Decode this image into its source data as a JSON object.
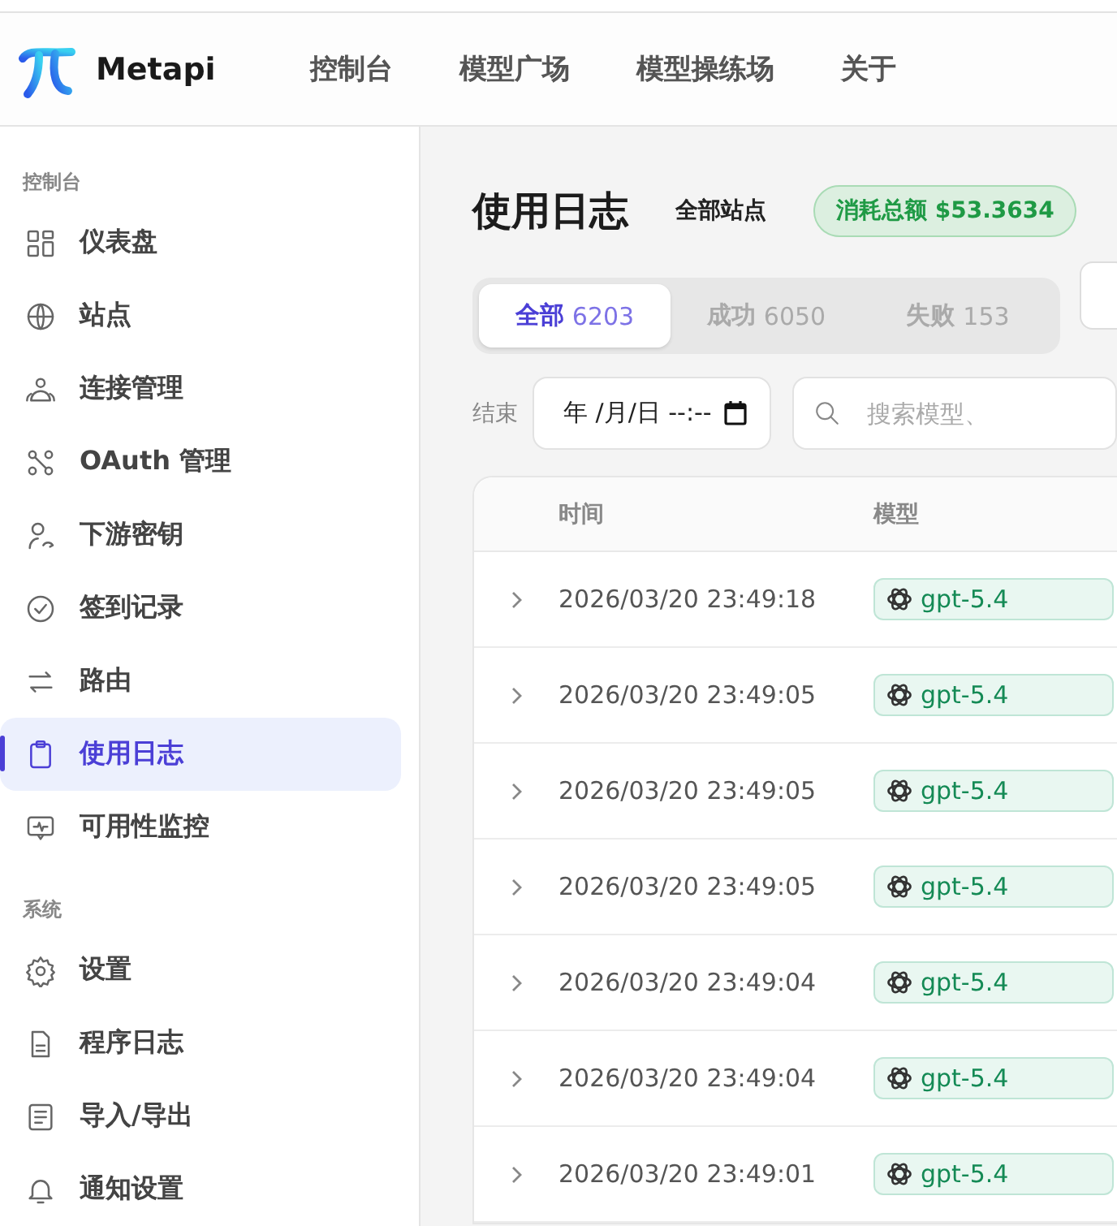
{
  "header": {
    "brand": "Metapi",
    "nav": [
      "控制台",
      "模型广场",
      "模型操练场",
      "关于"
    ]
  },
  "sidebar": {
    "sections": [
      {
        "title": "控制台",
        "items": [
          {
            "label": "仪表盘",
            "selected": false
          },
          {
            "label": "站点",
            "selected": false
          },
          {
            "label": "连接管理",
            "selected": false
          },
          {
            "label": "OAuth 管理",
            "selected": false
          },
          {
            "label": "下游密钥",
            "selected": false
          },
          {
            "label": "签到记录",
            "selected": false
          },
          {
            "label": "路由",
            "selected": false
          },
          {
            "label": "使用日志",
            "selected": true
          },
          {
            "label": "可用性监控",
            "selected": false
          }
        ]
      },
      {
        "title": "系统",
        "items": [
          {
            "label": "设置",
            "selected": false
          },
          {
            "label": "程序日志",
            "selected": false
          },
          {
            "label": "导入/导出",
            "selected": false
          },
          {
            "label": "通知设置",
            "selected": false
          }
        ]
      }
    ]
  },
  "page": {
    "title": "使用日志",
    "site_filter": "全部站点",
    "total_badge": "消耗总额 $53.3634",
    "tabs": [
      {
        "label": "全部",
        "count": "6203",
        "selected": true
      },
      {
        "label": "成功",
        "count": "6050",
        "selected": false
      },
      {
        "label": "失败",
        "count": "153",
        "selected": false
      }
    ],
    "end_label": "结束",
    "end_date": {
      "value": "年 /月/日 --:--"
    },
    "search": {
      "placeholder": "搜索模型、"
    },
    "table": {
      "columns": [
        "时间",
        "模型"
      ],
      "rows": [
        {
          "time": "2026/03/20 23:49:18",
          "model": "gpt-5.4"
        },
        {
          "time": "2026/03/20 23:49:05",
          "model": "gpt-5.4"
        },
        {
          "time": "2026/03/20 23:49:05",
          "model": "gpt-5.4"
        },
        {
          "time": "2026/03/20 23:49:05",
          "model": "gpt-5.4"
        },
        {
          "time": "2026/03/20 23:49:04",
          "model": "gpt-5.4"
        },
        {
          "time": "2026/03/20 23:49:04",
          "model": "gpt-5.4"
        },
        {
          "time": "2026/03/20 23:49:01",
          "model": "gpt-5.4"
        }
      ]
    }
  }
}
